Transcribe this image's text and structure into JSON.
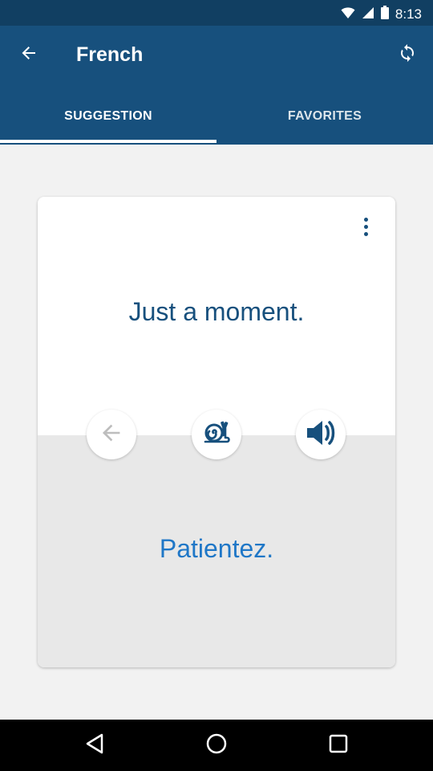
{
  "status_bar": {
    "time": "8:13",
    "icons": [
      "wifi-icon",
      "signal-icon",
      "battery-icon"
    ]
  },
  "app_bar": {
    "title": "French",
    "back_icon": "arrow-left-icon",
    "refresh_icon": "refresh-icon"
  },
  "tabs": [
    {
      "label": "SUGGESTION",
      "selected": true
    },
    {
      "label": "FAVORITES",
      "selected": false
    }
  ],
  "card": {
    "phrase": "Just a moment.",
    "translation": "Patientez.",
    "menu_icon": "more-vertical-icon",
    "actions": [
      {
        "icon": "arrow-left-icon",
        "name": "previous"
      },
      {
        "icon": "snail-icon",
        "name": "slow-playback"
      },
      {
        "icon": "speaker-icon",
        "name": "play-audio"
      }
    ]
  },
  "nav_bar": {
    "icons": [
      "back-triangle-icon",
      "home-circle-icon",
      "recents-square-icon"
    ]
  },
  "colors": {
    "status_bar": "#113f62",
    "app_bar": "#17507d",
    "accent_text": "#1f77c7",
    "background": "#f2f2f2",
    "card_bottom": "#e8e8e8"
  }
}
